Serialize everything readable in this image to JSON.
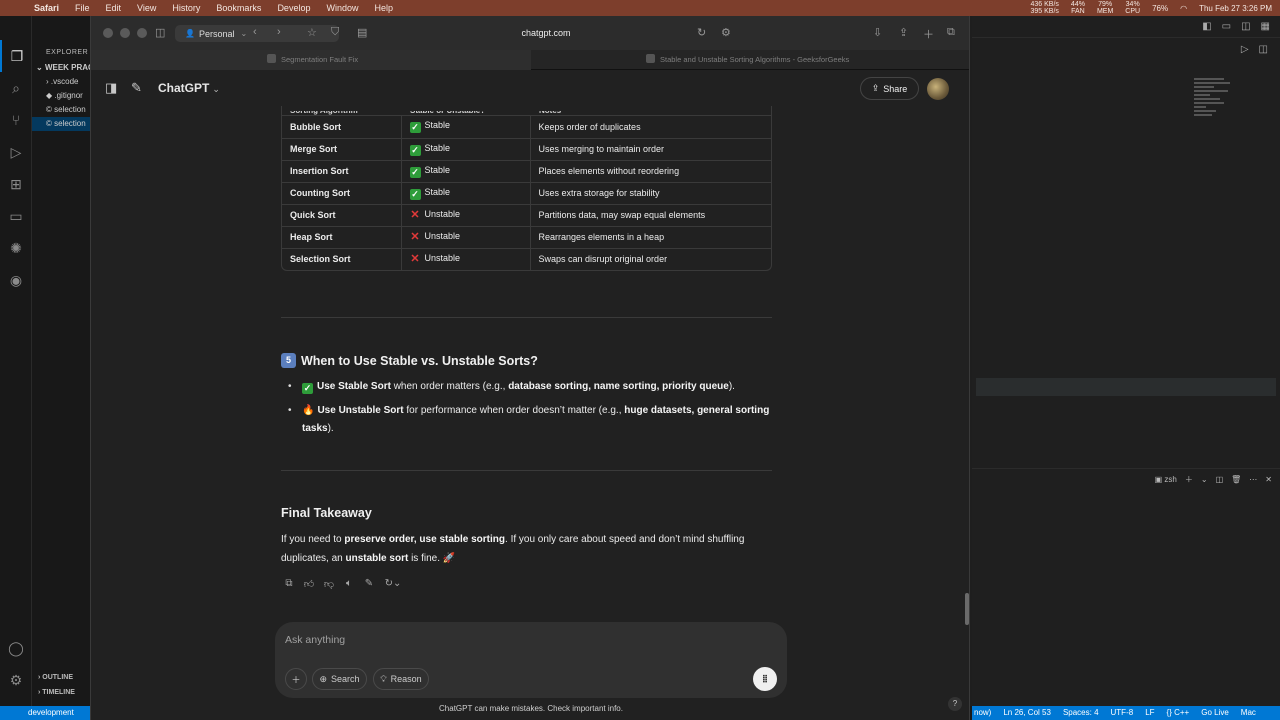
{
  "menubar": {
    "items": [
      "Safari",
      "File",
      "Edit",
      "View",
      "History",
      "Bookmarks",
      "Develop",
      "Window",
      "Help"
    ],
    "stats": [
      {
        "top": "436 KB/s",
        "bottom": "395 KB/s"
      },
      {
        "top": "44%",
        "bottom": "FAN"
      },
      {
        "top": "79%",
        "bottom": "MEM"
      },
      {
        "top": "34%",
        "bottom": "CPU"
      }
    ],
    "battery": "76%",
    "datetime": "Thu Feb 27  3:26 PM"
  },
  "vscode": {
    "explorer_label": "EXPLORER",
    "files": [
      "WEEK PRAC",
      ".vscode",
      ".gitignor",
      "selection",
      "selection"
    ],
    "outline_label": "OUTLINE",
    "timeline_label": "TIMELINE",
    "remote_label": "development",
    "terminal_shell": "zsh",
    "status_items": [
      "now)",
      "Ln 26, Col 53",
      "Spaces: 4",
      "UTF-8",
      "LF",
      "{} C++",
      "Go Live",
      "Mac"
    ]
  },
  "safari": {
    "profile": "Personal",
    "url": "chatgpt.com",
    "tabs": [
      {
        "label": "Segmentation Fault Fix"
      },
      {
        "label": "Stable and Unstable Sorting Algorithms - GeeksforGeeks"
      }
    ]
  },
  "chat": {
    "model": "ChatGPT",
    "share_label": "Share",
    "table_headers": [
      "Sorting Algorithm",
      "Stable or Unstable?",
      "Notes"
    ],
    "table_rows": [
      {
        "algo": "Bubble Sort",
        "stable": true,
        "stability": "Stable",
        "note": "Keeps order of duplicates"
      },
      {
        "algo": "Merge Sort",
        "stable": true,
        "stability": "Stable",
        "note": "Uses merging to maintain order"
      },
      {
        "algo": "Insertion Sort",
        "stable": true,
        "stability": "Stable",
        "note": "Places elements without reordering"
      },
      {
        "algo": "Counting Sort",
        "stable": true,
        "stability": "Stable",
        "note": "Uses extra storage for stability"
      },
      {
        "algo": "Quick Sort",
        "stable": false,
        "stability": "Unstable",
        "note": "Partitions data, may swap equal elements"
      },
      {
        "algo": "Heap Sort",
        "stable": false,
        "stability": "Unstable",
        "note": "Rearranges elements in a heap"
      },
      {
        "algo": "Selection Sort",
        "stable": false,
        "stability": "Unstable",
        "note": "Swaps can disrupt original order"
      }
    ],
    "section5": {
      "number": "5",
      "title": "When to Use Stable vs. Unstable Sorts?",
      "b1_bold": "Use Stable Sort",
      "b1_text": " when order matters (e.g., ",
      "b1_bold2": "database sorting, name sorting, priority queue",
      "b1_end": ").",
      "b2_bold": "Use Unstable Sort",
      "b2_text": " for performance when order doesn’t matter (e.g., ",
      "b2_bold2": "huge datasets, general sorting tasks",
      "b2_end": ")."
    },
    "final": {
      "title": "Final Takeaway",
      "t1": "If you need to ",
      "b1": "preserve order, use stable sorting",
      "t2": ". If you only care about speed and don’t mind shuffling duplicates, an ",
      "b2": "unstable sort",
      "t3": " is fine. 🚀"
    },
    "composer": {
      "placeholder": "Ask anything",
      "search_label": "Search",
      "reason_label": "Reason"
    },
    "disclaimer": "ChatGPT can make mistakes. Check important info.",
    "help": "?"
  }
}
